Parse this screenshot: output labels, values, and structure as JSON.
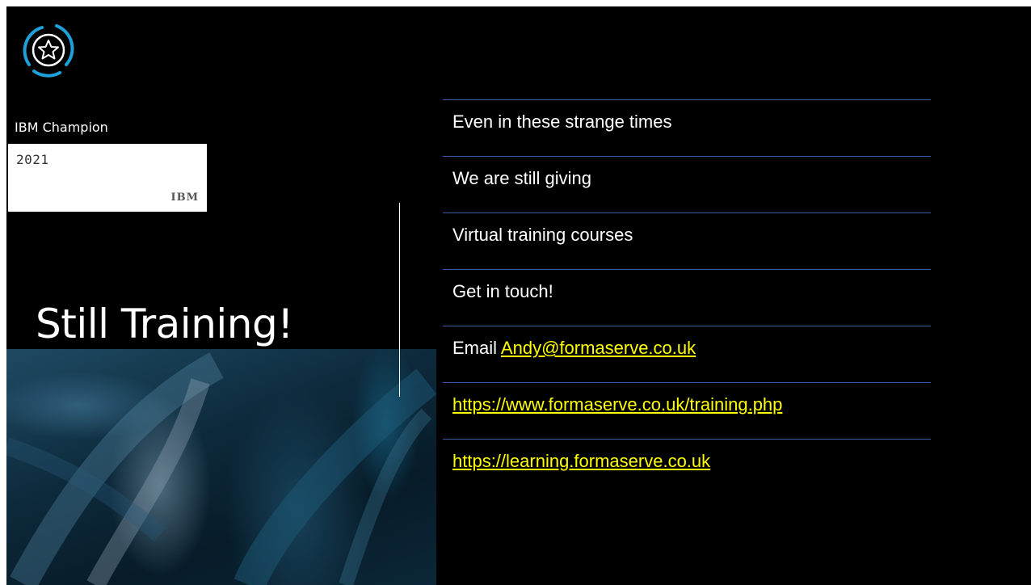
{
  "badge": {
    "label": "IBM Champion",
    "year": "2021",
    "brand": "IBM"
  },
  "title": "Still Training!",
  "items": [
    {
      "text": "Even in these strange times"
    },
    {
      "text": "We are still giving"
    },
    {
      "text": "Virtual training courses"
    },
    {
      "text": "Get in touch!"
    },
    {
      "prefix": "Email ",
      "link": "Andy@formaserve.co.uk"
    },
    {
      "link": "https://www.formaserve.co.uk/training.php"
    },
    {
      "link": "https://learning.formaserve.co.uk"
    }
  ],
  "colors": {
    "background": "#000000",
    "link": "#ffff00",
    "rule": "#3a5aa8",
    "logo_arc": "#1da1d8"
  },
  "icons": {
    "logo": "star-badge-icon"
  }
}
